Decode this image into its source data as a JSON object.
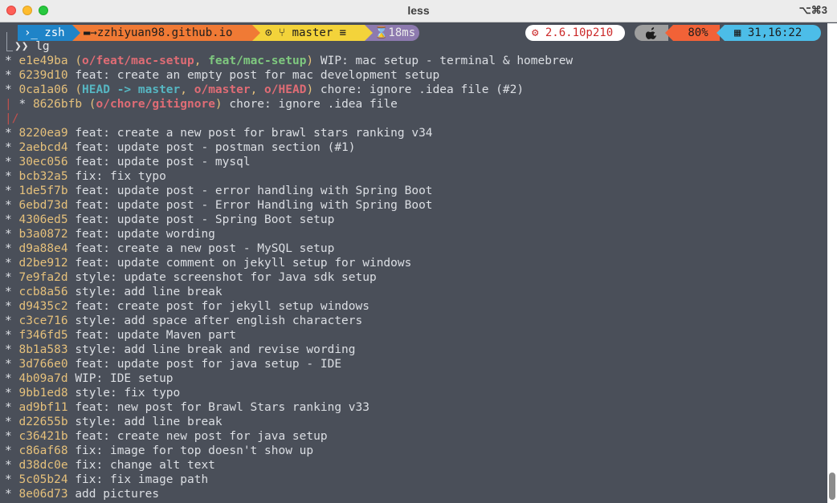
{
  "window": {
    "title": "less",
    "shortcut": "⌥⌘3"
  },
  "prompt": {
    "shell": "›_ zsh",
    "path": "▬→zzhiyuan98.github.io",
    "git": "⊙ ⑂ master ≡",
    "duration": "⌛18ms",
    "version": "⚙ 2.6.10p210",
    "os": "",
    "battery": "80%",
    "clock": "▦ 31,16:22"
  },
  "command": "❯❯ lg",
  "commits": [
    {
      "hash": "e1e49ba",
      "refs": [
        {
          "text": "o/feat/mac-setup",
          "style": "red"
        },
        {
          "text": "feat/mac-setup",
          "style": "green"
        }
      ],
      "msg": "WIP: mac setup - terminal & homebrew"
    },
    {
      "hash": "6239d10",
      "msg": "feat: create an empty post for mac development setup"
    },
    {
      "hash": "0ca1a06",
      "refs": [
        {
          "text": "HEAD -> master",
          "style": "head"
        },
        {
          "text": "o/master",
          "style": "red"
        },
        {
          "text": "o/HEAD",
          "style": "red"
        }
      ],
      "msg": "chore: ignore .idea file (#2)"
    },
    {
      "hash": "8626bfb",
      "branch": true,
      "refs": [
        {
          "text": "o/chore/gitignore",
          "style": "red"
        }
      ],
      "msg": "chore: ignore .idea file"
    },
    {
      "merge": true
    },
    {
      "hash": "8220ea9",
      "msg": "feat: create a new post for brawl stars ranking v34"
    },
    {
      "hash": "2aebcd4",
      "msg": "feat: update post - postman section (#1)"
    },
    {
      "hash": "30ec056",
      "msg": "feat: update post - mysql"
    },
    {
      "hash": "bcb32a5",
      "msg": "fix: fix typo"
    },
    {
      "hash": "1de5f7b",
      "msg": "feat: update post - error handling with Spring Boot"
    },
    {
      "hash": "6ebd73d",
      "msg": "feat: update post - Error Handling with Spring Boot"
    },
    {
      "hash": "4306ed5",
      "msg": "feat: update post - Spring Boot setup"
    },
    {
      "hash": "b3a0872",
      "msg": "feat: update wording"
    },
    {
      "hash": "d9a88e4",
      "msg": "feat: create a new post - MySQL setup"
    },
    {
      "hash": "d2be912",
      "msg": "feat: update comment on jekyll setup for windows"
    },
    {
      "hash": "7e9fa2d",
      "msg": "style: update screenshot for Java sdk setup"
    },
    {
      "hash": "ccb8a56",
      "msg": "style: add line break"
    },
    {
      "hash": "d9435c2",
      "msg": "feat: create post for jekyll setup windows"
    },
    {
      "hash": "c3ce716",
      "msg": "style: add space after english characters"
    },
    {
      "hash": "f346fd5",
      "msg": "feat: update Maven part"
    },
    {
      "hash": "8b1a583",
      "msg": "style: add line break and revise wording"
    },
    {
      "hash": "3d766e0",
      "msg": "feat: update post for java setup - IDE"
    },
    {
      "hash": "4b09a7d",
      "msg": "WIP: IDE setup"
    },
    {
      "hash": "9bb1ed8",
      "msg": "style: fix typo"
    },
    {
      "hash": "ad9bf11",
      "msg": "feat: new post for Brawl Stars ranking v33"
    },
    {
      "hash": "d22655b",
      "msg": "style: add line break"
    },
    {
      "hash": "c36421b",
      "msg": "feat: create new post for java setup"
    },
    {
      "hash": "c86af68",
      "msg": "fix: image for top doesn't show up"
    },
    {
      "hash": "d38dc0e",
      "msg": "fix: change alt text"
    },
    {
      "hash": "5c05b24",
      "msg": "fix: fix image path"
    },
    {
      "hash": "8e06d73",
      "msg": "add pictures"
    }
  ]
}
